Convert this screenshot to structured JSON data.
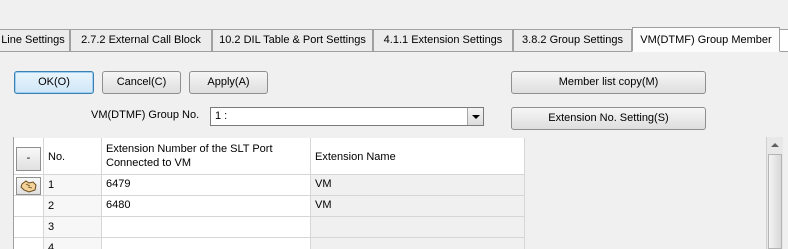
{
  "tabs": [
    {
      "label": "Line Settings"
    },
    {
      "label": "2.7.2 External Call Block"
    },
    {
      "label": "10.2 DIL Table & Port Settings"
    },
    {
      "label": "4.1.1 Extension Settings"
    },
    {
      "label": "3.8.2 Group Settings"
    },
    {
      "label": "VM(DTMF) Group Member",
      "active": true
    }
  ],
  "buttons": {
    "ok": "OK(O)",
    "cancel": "Cancel(C)",
    "apply": "Apply(A)",
    "member_list_copy": "Member list copy(M)",
    "extension_no_setting": "Extension No. Setting(S)"
  },
  "group_select": {
    "label": "VM(DTMF) Group No.",
    "value": "1 :"
  },
  "table": {
    "corner_button": "-",
    "headers": {
      "no": "No.",
      "ext_line1": "Extension Number of the SLT Port",
      "ext_line2": "Connected to VM",
      "name": "Extension Name"
    },
    "rows": [
      {
        "no": "1",
        "extension": "6479",
        "name": "VM"
      },
      {
        "no": "2",
        "extension": "6480",
        "name": "VM"
      },
      {
        "no": "3",
        "extension": "",
        "name": ""
      },
      {
        "no": "4",
        "extension": "",
        "name": ""
      }
    ]
  },
  "icons": {
    "row_pointer": "hand-pointer-icon",
    "scroll_up": "scroll-up-arrow-icon",
    "dropdown": "dropdown-arrow-icon"
  },
  "colors": {
    "background": "#f0f0f0",
    "default_button_border": "#3c7fb1"
  }
}
